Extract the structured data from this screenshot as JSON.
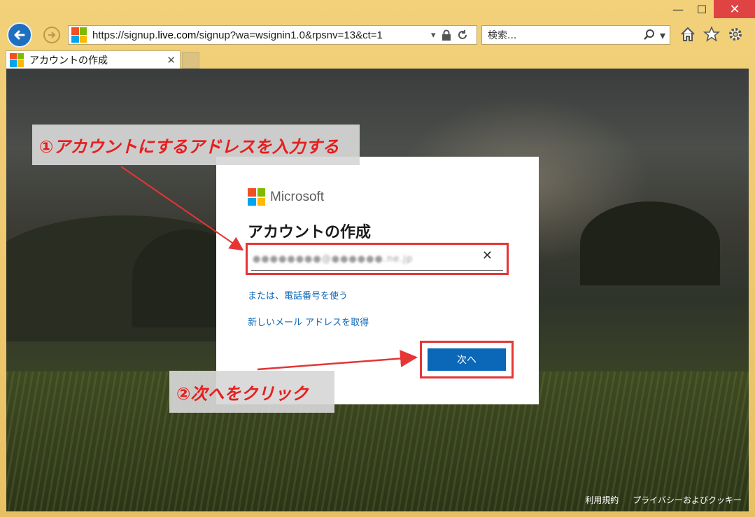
{
  "window": {
    "minimize_label": "—",
    "maximize_label": "☐",
    "close_label": "✕"
  },
  "nav": {
    "url_prefix": "https://signup.",
    "url_domain": "live.com",
    "url_rest": "/signup?wa=wsignin1.0&rpsnv=13&ct=1",
    "search_placeholder": "検索...",
    "icons": [
      "back-icon",
      "forward-icon",
      "lock-icon",
      "refresh-icon",
      "search-icon",
      "home-icon",
      "favorites-star-icon",
      "settings-gear-icon"
    ]
  },
  "tab": {
    "title": "アカウントの作成",
    "close_label": "✕"
  },
  "dialog": {
    "brand": "Microsoft",
    "heading": "アカウントの作成",
    "email_value": "●●●●●●●●@●●●●●●.ne.jp",
    "clear_label": "✕",
    "phone_link": "または、電話番号を使う",
    "new_email_link": "新しいメール アドレスを取得",
    "next_label": "次へ"
  },
  "annotations": {
    "step1": "①アカウントにするアドレスを入力する",
    "step2": "②次へをクリック"
  },
  "footer": {
    "terms": "利用規約",
    "privacy": "プライバシーおよびクッキー"
  },
  "colors": {
    "ms_red": "#f25022",
    "ms_green": "#7fba00",
    "ms_blue": "#00a4ef",
    "ms_yellow": "#ffb900",
    "accent_blue": "#0b67b8",
    "annotation_red": "#e53535"
  }
}
